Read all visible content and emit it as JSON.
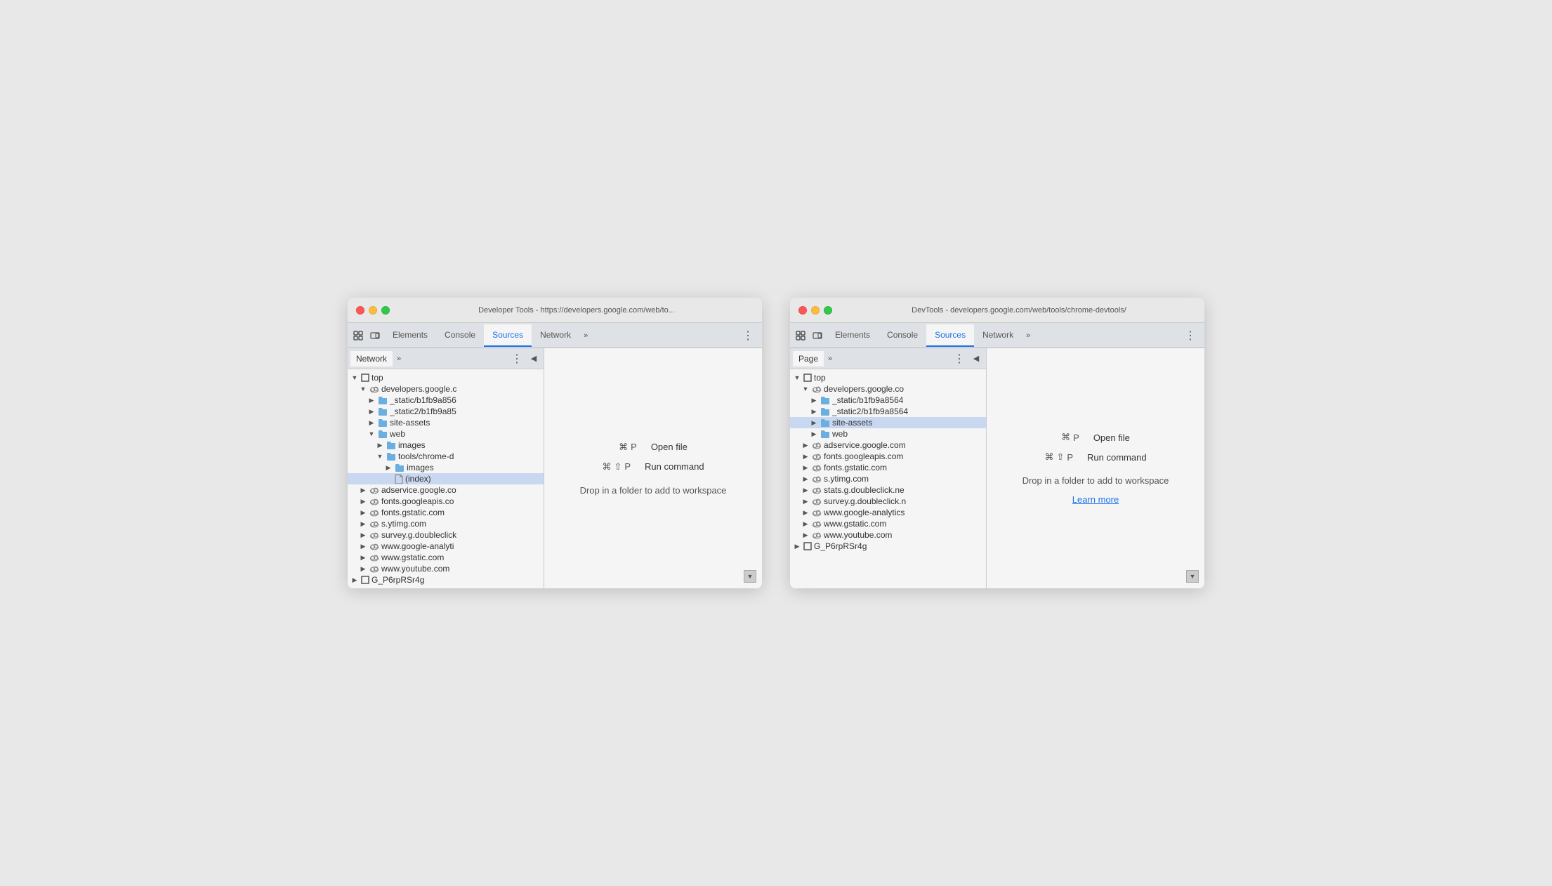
{
  "window1": {
    "title": "Developer Tools - https://developers.google.com/web/to...",
    "tabs": [
      {
        "label": "Elements",
        "active": false
      },
      {
        "label": "Console",
        "active": false
      },
      {
        "label": "Sources",
        "active": true
      },
      {
        "label": "Network",
        "active": false
      }
    ],
    "left_panel": {
      "tab": "Network",
      "tree_items": [
        {
          "label": "top",
          "indent": 0,
          "arrow": "open",
          "icon": "square"
        },
        {
          "label": "developers.google.c",
          "indent": 1,
          "arrow": "open",
          "icon": "cloud"
        },
        {
          "label": "_static/b1fb9a856",
          "indent": 2,
          "arrow": "closed",
          "icon": "folder"
        },
        {
          "label": "_static2/b1fb9a85",
          "indent": 2,
          "arrow": "closed",
          "icon": "folder"
        },
        {
          "label": "site-assets",
          "indent": 2,
          "arrow": "closed",
          "icon": "folder"
        },
        {
          "label": "web",
          "indent": 2,
          "arrow": "open",
          "icon": "folder"
        },
        {
          "label": "images",
          "indent": 3,
          "arrow": "closed",
          "icon": "folder"
        },
        {
          "label": "tools/chrome-d",
          "indent": 3,
          "arrow": "open",
          "icon": "folder"
        },
        {
          "label": "images",
          "indent": 4,
          "arrow": "closed",
          "icon": "folder"
        },
        {
          "label": "(index)",
          "indent": 4,
          "arrow": "none",
          "icon": "file",
          "selected": true
        },
        {
          "label": "adservice.google.co",
          "indent": 1,
          "arrow": "closed",
          "icon": "cloud"
        },
        {
          "label": "fonts.googleapis.co",
          "indent": 1,
          "arrow": "closed",
          "icon": "cloud"
        },
        {
          "label": "fonts.gstatic.com",
          "indent": 1,
          "arrow": "closed",
          "icon": "cloud"
        },
        {
          "label": "s.ytimg.com",
          "indent": 1,
          "arrow": "closed",
          "icon": "cloud"
        },
        {
          "label": "survey.g.doubleclick",
          "indent": 1,
          "arrow": "closed",
          "icon": "cloud"
        },
        {
          "label": "www.google-analyti",
          "indent": 1,
          "arrow": "closed",
          "icon": "cloud"
        },
        {
          "label": "www.gstatic.com",
          "indent": 1,
          "arrow": "closed",
          "icon": "cloud"
        },
        {
          "label": "www.youtube.com",
          "indent": 1,
          "arrow": "closed",
          "icon": "cloud"
        },
        {
          "label": "G_P6rpRSr4g",
          "indent": 0,
          "arrow": "closed",
          "icon": "square"
        }
      ]
    },
    "editor": {
      "shortcut1_keys": [
        "⌘",
        "P"
      ],
      "shortcut1_label": "Open file",
      "shortcut2_keys": [
        "⌘",
        "⇧",
        "P"
      ],
      "shortcut2_label": "Run command",
      "drop_text": "Drop in a folder to add to workspace",
      "learn_more": null
    }
  },
  "window2": {
    "title": "DevTools - developers.google.com/web/tools/chrome-devtools/",
    "tabs": [
      {
        "label": "Elements",
        "active": false
      },
      {
        "label": "Console",
        "active": false
      },
      {
        "label": "Sources",
        "active": true
      },
      {
        "label": "Network",
        "active": false
      }
    ],
    "left_panel": {
      "tab": "Page",
      "tree_items": [
        {
          "label": "top",
          "indent": 0,
          "arrow": "open",
          "icon": "square"
        },
        {
          "label": "developers.google.co",
          "indent": 1,
          "arrow": "open",
          "icon": "cloud"
        },
        {
          "label": "_static/b1fb9a8564",
          "indent": 2,
          "arrow": "closed",
          "icon": "folder"
        },
        {
          "label": "_static2/b1fb9a8564",
          "indent": 2,
          "arrow": "closed",
          "icon": "folder"
        },
        {
          "label": "site-assets",
          "indent": 2,
          "arrow": "closed",
          "icon": "folder",
          "selected": true
        },
        {
          "label": "web",
          "indent": 2,
          "arrow": "closed",
          "icon": "folder"
        },
        {
          "label": "adservice.google.com",
          "indent": 1,
          "arrow": "closed",
          "icon": "cloud"
        },
        {
          "label": "fonts.googleapis.com",
          "indent": 1,
          "arrow": "closed",
          "icon": "cloud"
        },
        {
          "label": "fonts.gstatic.com",
          "indent": 1,
          "arrow": "closed",
          "icon": "cloud"
        },
        {
          "label": "s.ytimg.com",
          "indent": 1,
          "arrow": "closed",
          "icon": "cloud"
        },
        {
          "label": "stats.g.doubleclick.ne",
          "indent": 1,
          "arrow": "closed",
          "icon": "cloud"
        },
        {
          "label": "survey.g.doubleclick.n",
          "indent": 1,
          "arrow": "closed",
          "icon": "cloud"
        },
        {
          "label": "www.google-analytics",
          "indent": 1,
          "arrow": "closed",
          "icon": "cloud"
        },
        {
          "label": "www.gstatic.com",
          "indent": 1,
          "arrow": "closed",
          "icon": "cloud"
        },
        {
          "label": "www.youtube.com",
          "indent": 1,
          "arrow": "closed",
          "icon": "cloud"
        },
        {
          "label": "G_P6rpRSr4g",
          "indent": 0,
          "arrow": "closed",
          "icon": "square"
        }
      ]
    },
    "editor": {
      "shortcut1_keys": [
        "⌘",
        "P"
      ],
      "shortcut1_label": "Open file",
      "shortcut2_keys": [
        "⌘",
        "⇧",
        "P"
      ],
      "shortcut2_label": "Run command",
      "drop_text": "Drop in a folder to add to workspace",
      "learn_more": "Learn more"
    }
  },
  "icons": {
    "close": "✕",
    "more": "»",
    "dots": "⋮",
    "collapse": "◀",
    "scroll_down": "▼"
  }
}
